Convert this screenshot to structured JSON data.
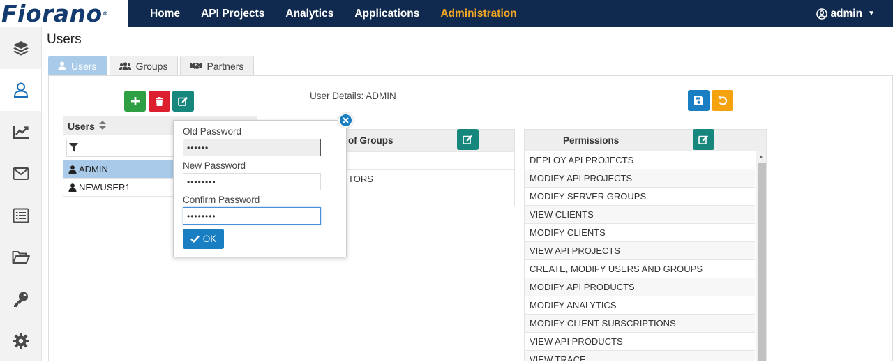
{
  "brand": {
    "logo_text": "Fiorano",
    "trademark": "®"
  },
  "nav": {
    "items": [
      {
        "label": "Home"
      },
      {
        "label": "API Projects"
      },
      {
        "label": "Analytics"
      },
      {
        "label": "Applications"
      },
      {
        "label": "Administration",
        "active": true
      }
    ],
    "user": "admin"
  },
  "sidebar": {
    "items": [
      {
        "icon": "layers-icon"
      },
      {
        "icon": "user-icon",
        "active": true
      },
      {
        "icon": "chart-icon"
      },
      {
        "icon": "envelope-icon"
      },
      {
        "icon": "list-icon"
      },
      {
        "icon": "folder-open-icon"
      },
      {
        "icon": "key-icon"
      },
      {
        "icon": "gear-icon"
      }
    ]
  },
  "page": {
    "title": "Users"
  },
  "tabs": [
    {
      "label": "Users",
      "active": true
    },
    {
      "label": "Groups"
    },
    {
      "label": "Partners"
    }
  ],
  "details": {
    "label": "User Details: ADMIN"
  },
  "users": {
    "header": "Users",
    "filter_value": "",
    "rows": [
      {
        "name": "ADMIN",
        "selected": true
      },
      {
        "name": "NEWUSER1"
      }
    ]
  },
  "groups": {
    "header": "of Groups",
    "rows": [
      "",
      "TORS",
      ""
    ]
  },
  "permissions": {
    "header": "Permissions",
    "rows": [
      "DEPLOY API PROJECTS",
      "MODIFY API PROJECTS",
      "MODIFY SERVER GROUPS",
      "VIEW CLIENTS",
      "MODIFY CLIENTS",
      "VIEW API PROJECTS",
      "CREATE, MODIFY USERS AND GROUPS",
      "MODIFY API PRODUCTS",
      "MODIFY ANALYTICS",
      "MODIFY CLIENT SUBSCRIPTIONS",
      "VIEW API PRODUCTS",
      "VIEW TRACE"
    ]
  },
  "password_popover": {
    "old_label": "Old Password",
    "old_value": "••••••",
    "new_label": "New Password",
    "new_value": "••••••••",
    "confirm_label": "Confirm Password",
    "confirm_value": "••••••••",
    "ok_label": "OK"
  },
  "colors": {
    "topbar": "#0f2a4e",
    "active_nav": "#f5a623",
    "selected_row": "#a9cbe9",
    "primary": "#1a7ec2",
    "add": "#2ea043",
    "delete": "#dc1f2e",
    "edit": "#17877d",
    "reset": "#f5a20f"
  }
}
